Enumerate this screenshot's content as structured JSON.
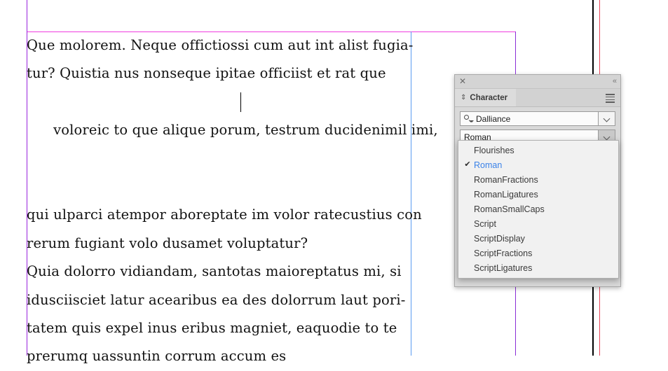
{
  "document": {
    "text_lines": [
      "Que molorem. Neque offictiossi cum aut int alist fugia-",
      "tur? Quistia nus nonseque ipitae officiist et rat que",
      "voloreic to que alique porum, testrum ducidenimil imi,",
      "qui ulparci atempor aboreptate im volor ratecustius con",
      "rerum fugiant volo dusamet voluptatur?",
      "Quia dolorro vidiandam, santotas maioreptatus mi, si",
      "idusciisciet latur acearibus ea des dolorrum laut pori-",
      "tatem quis expel inus eribus magniet, eaquodie to te",
      "prerumq uassuntin corrum accum es"
    ],
    "caret_line_index": 2,
    "guides": {
      "top_margin_color": "#f03ce0",
      "left_margin_color": "#9922dd",
      "right_margin_color": "#8b2fd6",
      "column_color": "#5b9bf0",
      "page_edge_color": "#000000",
      "bleed_color": "#e8485c"
    }
  },
  "panel": {
    "titlebar": {
      "close_icon": "close-icon",
      "collapse_icon": "collapse-double-chevron-icon",
      "collapse_glyph": "«"
    },
    "tab": {
      "label": "Character",
      "handle_glyph": "⇕",
      "menu_icon": "panel-menu-icon"
    },
    "font_family": {
      "value": "Dalliance",
      "search_icon": "search-icon"
    },
    "font_style": {
      "value": "Roman"
    }
  },
  "dropdown": {
    "check_glyph": "✔",
    "selected_color": "#3b82e8",
    "items": [
      {
        "label": "Flourishes",
        "selected": false
      },
      {
        "label": "Roman",
        "selected": true
      },
      {
        "label": "RomanFractions",
        "selected": false
      },
      {
        "label": "RomanLigatures",
        "selected": false
      },
      {
        "label": "RomanSmallCaps",
        "selected": false
      },
      {
        "label": "Script",
        "selected": false
      },
      {
        "label": "ScriptDisplay",
        "selected": false
      },
      {
        "label": "ScriptFractions",
        "selected": false
      },
      {
        "label": "ScriptLigatures",
        "selected": false
      }
    ]
  }
}
